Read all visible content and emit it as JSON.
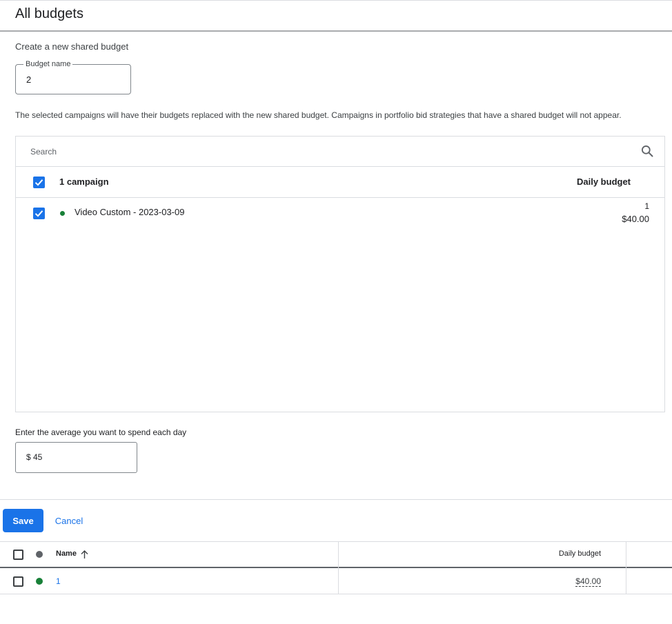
{
  "header": {
    "title": "All budgets"
  },
  "form": {
    "section_title": "Create a new shared budget",
    "budget_name_label": "Budget name",
    "budget_name_value": "2",
    "info_text": "The selected campaigns will have their budgets replaced with the new shared budget. Campaigns in portfolio bid strategies that have a shared budget will not appear."
  },
  "picker": {
    "search_placeholder": "Search",
    "search_icon": "search-icon",
    "header_count": "1 campaign",
    "header_daily_budget": "Daily budget",
    "header_checked": true,
    "rows": [
      {
        "checked": true,
        "status_color": "#188038",
        "name": "Video Custom - 2023-03-09",
        "budget_name": "1",
        "budget_amount": "$40.00"
      }
    ]
  },
  "amount": {
    "label": "Enter the average you want to spend each day",
    "value": "$ 45"
  },
  "actions": {
    "save_label": "Save",
    "cancel_label": "Cancel"
  },
  "budgets_table": {
    "columns": {
      "name": "Name",
      "daily_budget": "Daily budget"
    },
    "sort_icon": "arrow-up-icon",
    "rows": [
      {
        "status_color": "#188038",
        "name": "1",
        "daily_budget": "$40.00"
      }
    ]
  },
  "colors": {
    "accent": "#1a73e8",
    "status_enabled": "#188038",
    "status_all": "#5f6368"
  }
}
